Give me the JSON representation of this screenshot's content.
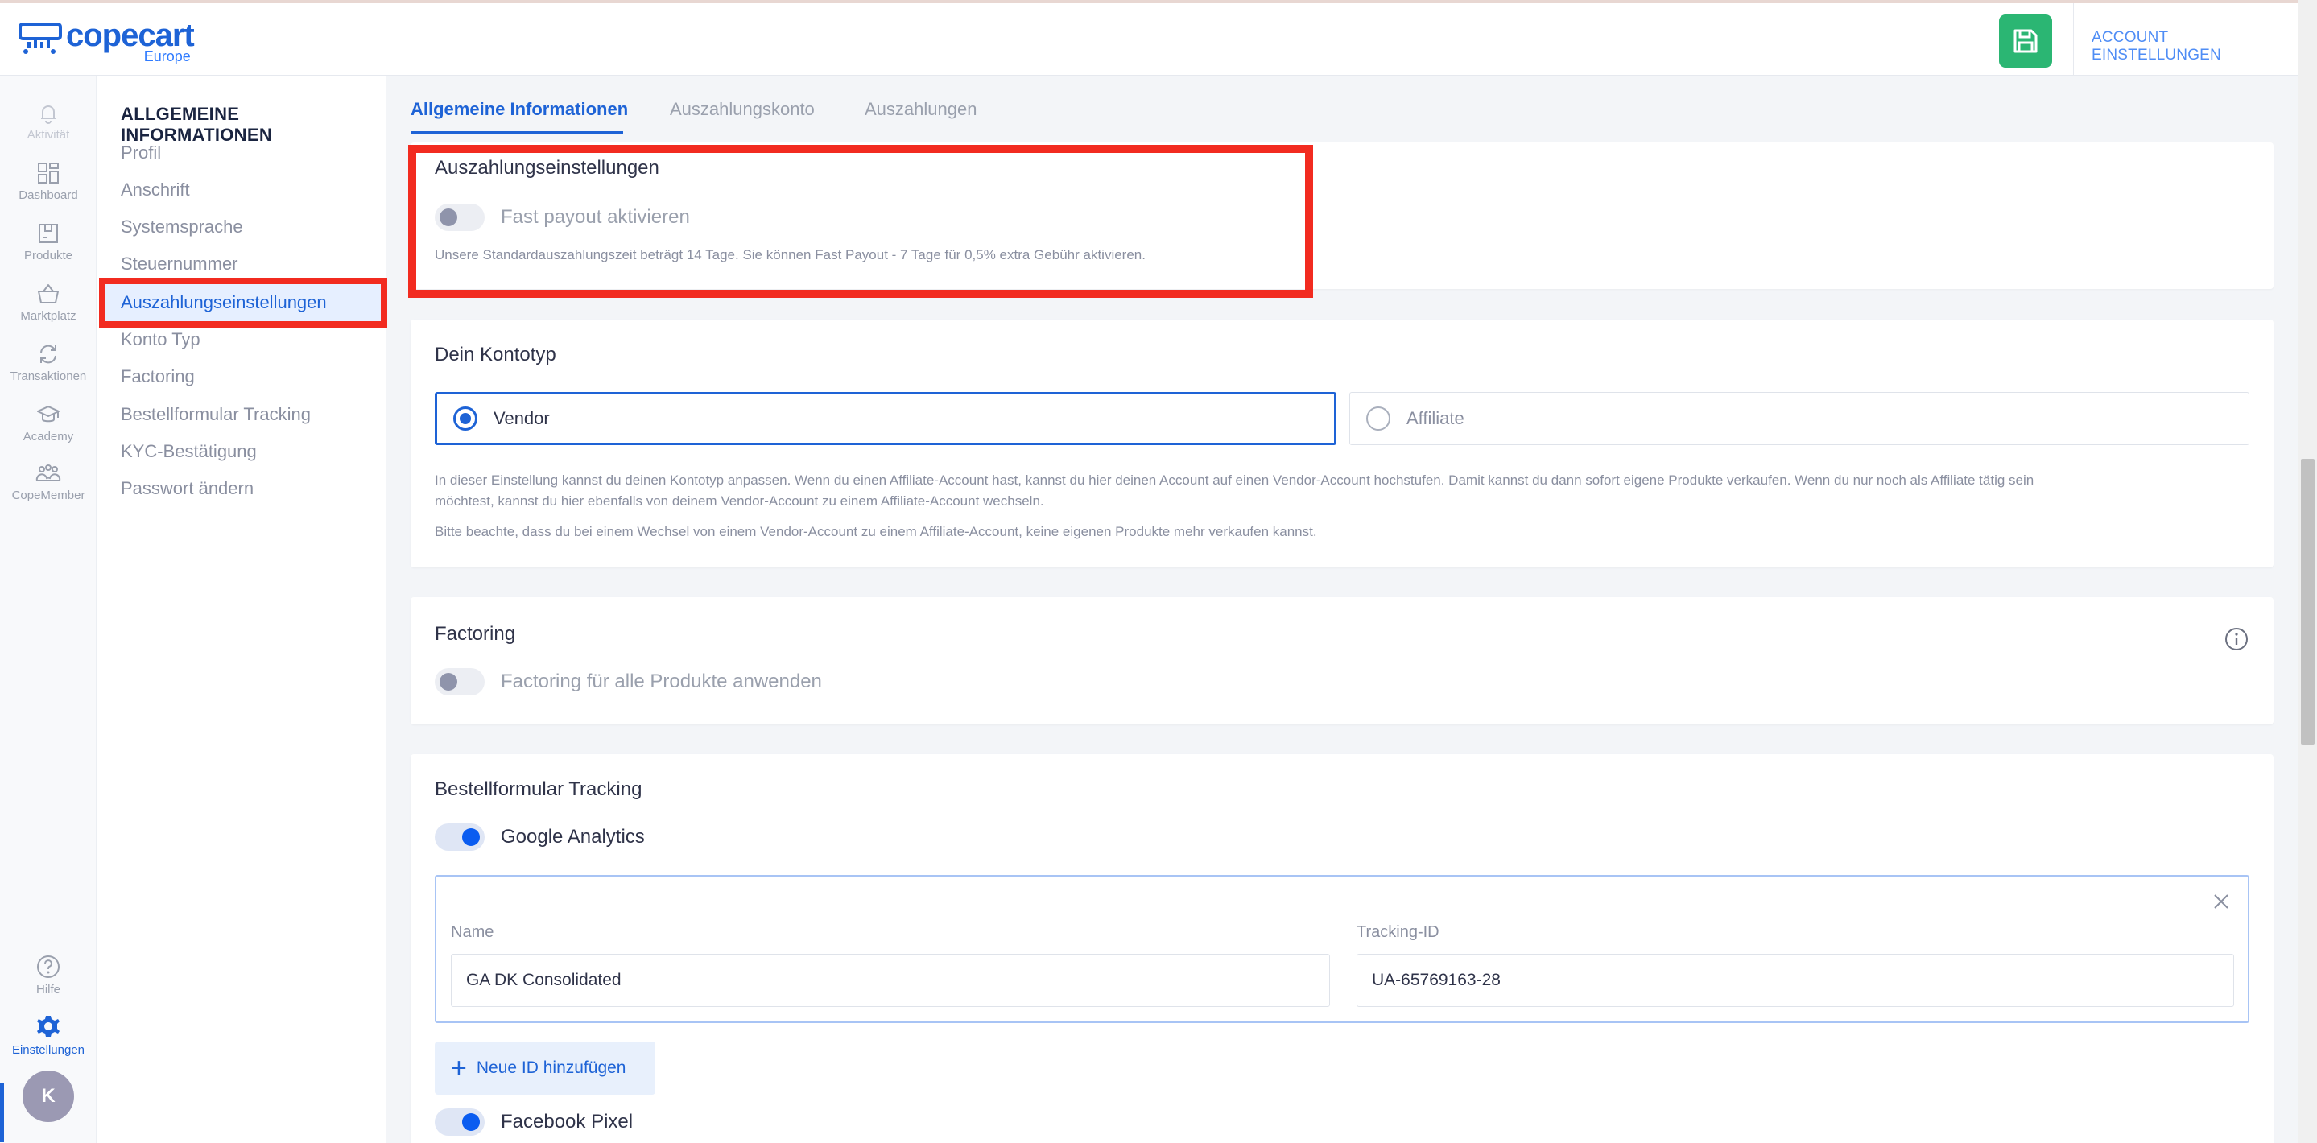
{
  "brand": {
    "name": "copecart",
    "sub": "Europe"
  },
  "header": {
    "account_label": "ACCOUNT EINSTELLUNGEN"
  },
  "rail": [
    {
      "label": "Aktivität",
      "icon": "bell-icon"
    },
    {
      "label": "Dashboard",
      "icon": "grid-icon"
    },
    {
      "label": "Produkte",
      "icon": "box-icon"
    },
    {
      "label": "Marktplatz",
      "icon": "basket-icon"
    },
    {
      "label": "Transaktionen",
      "icon": "refresh-icon"
    },
    {
      "label": "Academy",
      "icon": "graduation-cap-icon"
    },
    {
      "label": "CopeMember",
      "icon": "people-icon"
    }
  ],
  "rail_bottom": {
    "help": "Hilfe",
    "settings": "Einstellungen",
    "avatar": "K"
  },
  "subnav": {
    "title": "ALLGEMEINE INFORMATIONEN",
    "items": [
      "Profil",
      "Anschrift",
      "Systemsprache",
      "Steuernummer",
      "Auszahlungseinstellungen",
      "Konto Typ",
      "Factoring",
      "Bestellformular Tracking",
      "KYC-Bestätigung",
      "Passwort ändern"
    ]
  },
  "tabs": [
    "Allgemeine Informationen",
    "Auszahlungskonto",
    "Auszahlungen"
  ],
  "payout": {
    "title": "Auszahlungseinstellungen",
    "toggle_label": "Fast payout aktivieren",
    "toggle_on": false,
    "hint": "Unsere Standardauszahlungszeit beträgt 14 Tage. Sie können Fast Payout - 7 Tage für 0,5% extra Gebühr aktivieren."
  },
  "account_type": {
    "title": "Dein Kontotyp",
    "options": [
      "Vendor",
      "Affiliate"
    ],
    "selected": "Vendor",
    "hint1": "In dieser Einstellung kannst du deinen Kontotyp anpassen. Wenn du einen Affiliate-Account hast, kannst du hier deinen Account auf einen Vendor-Account hochstufen. Damit kannst du dann sofort eigene Produkte verkaufen. Wenn du nur noch als Affiliate tätig sein",
    "hint2": "möchtest, kannst du hier ebenfalls von deinem Vendor-Account zu einem Affiliate-Account wechseln.",
    "hint3": "Bitte beachte, dass du bei einem Wechsel von einem Vendor-Account zu einem Affiliate-Account, keine eigenen Produkte mehr verkaufen kannst."
  },
  "factoring": {
    "title": "Factoring",
    "toggle_label": "Factoring für alle Produkte anwenden",
    "toggle_on": false
  },
  "tracking": {
    "title": "Bestellformular Tracking",
    "google_label": "Google Analytics",
    "google_on": true,
    "name_label": "Name",
    "name_value": "GA DK Consolidated",
    "id_label": "Tracking-ID",
    "id_value": "UA-65769163-28",
    "add_label": "Neue ID hinzufügen",
    "facebook_label": "Facebook Pixel",
    "facebook_on": true
  },
  "colors": {
    "accent": "#1e63d6",
    "save_green": "#2bb673",
    "highlight_red": "#f22b20"
  }
}
